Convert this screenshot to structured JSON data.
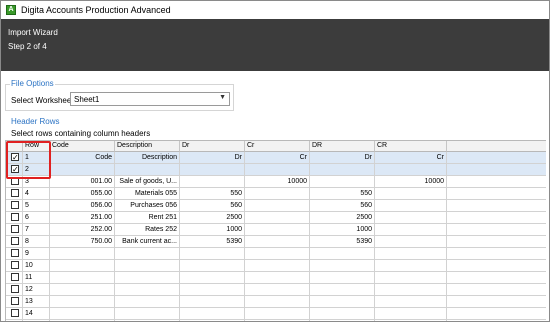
{
  "window": {
    "title": "Digita Accounts Production Advanced",
    "icon": "app-logo-icon"
  },
  "wizard": {
    "title": "Import Wizard",
    "step": "Step 2 of 4"
  },
  "file_options": {
    "group_label": "File Options",
    "worksheet_label": "Select Worksheet",
    "worksheet_value": "Sheet1"
  },
  "header_rows": {
    "group_label": "Header Rows",
    "instruction": "Select rows containing column headers"
  },
  "grid": {
    "columns": [
      "Row",
      "Code",
      "Description",
      "Dr",
      "Cr",
      "DR",
      "CR"
    ],
    "rows": [
      {
        "row": "1",
        "checked": true,
        "selected": true,
        "code": "Code",
        "description": "Description",
        "dr": "Dr",
        "cr": "Cr",
        "DR": "Dr",
        "CR": "Cr"
      },
      {
        "row": "2",
        "checked": true,
        "selected": true,
        "code": "",
        "description": "",
        "dr": "",
        "cr": "",
        "DR": "",
        "CR": ""
      },
      {
        "row": "3",
        "checked": false,
        "selected": false,
        "code": "001.00",
        "description": "Sale of goods, U...",
        "dr": "",
        "cr": "10000",
        "DR": "",
        "CR": "10000"
      },
      {
        "row": "4",
        "checked": false,
        "selected": false,
        "code": "055.00",
        "description": "Materials 055",
        "dr": "550",
        "cr": "",
        "DR": "550",
        "CR": ""
      },
      {
        "row": "5",
        "checked": false,
        "selected": false,
        "code": "056.00",
        "description": "Purchases 056",
        "dr": "560",
        "cr": "",
        "DR": "560",
        "CR": ""
      },
      {
        "row": "6",
        "checked": false,
        "selected": false,
        "code": "251.00",
        "description": "Rent 251",
        "dr": "2500",
        "cr": "",
        "DR": "2500",
        "CR": ""
      },
      {
        "row": "7",
        "checked": false,
        "selected": false,
        "code": "252.00",
        "description": "Rates 252",
        "dr": "1000",
        "cr": "",
        "DR": "1000",
        "CR": ""
      },
      {
        "row": "8",
        "checked": false,
        "selected": false,
        "code": "750.00",
        "description": "Bank current ac...",
        "dr": "5390",
        "cr": "",
        "DR": "5390",
        "CR": ""
      },
      {
        "row": "9",
        "checked": false,
        "selected": false,
        "code": "",
        "description": "",
        "dr": "",
        "cr": "",
        "DR": "",
        "CR": ""
      },
      {
        "row": "10",
        "checked": false,
        "selected": false,
        "code": "",
        "description": "",
        "dr": "",
        "cr": "",
        "DR": "",
        "CR": ""
      },
      {
        "row": "11",
        "checked": false,
        "selected": false,
        "code": "",
        "description": "",
        "dr": "",
        "cr": "",
        "DR": "",
        "CR": ""
      },
      {
        "row": "12",
        "checked": false,
        "selected": false,
        "code": "",
        "description": "",
        "dr": "",
        "cr": "",
        "DR": "",
        "CR": ""
      },
      {
        "row": "13",
        "checked": false,
        "selected": false,
        "code": "",
        "description": "",
        "dr": "",
        "cr": "",
        "DR": "",
        "CR": ""
      },
      {
        "row": "14",
        "checked": false,
        "selected": false,
        "code": "",
        "description": "",
        "dr": "",
        "cr": "",
        "DR": "",
        "CR": ""
      },
      {
        "row": "15",
        "checked": false,
        "selected": false,
        "code": "",
        "description": "",
        "dr": "",
        "cr": "",
        "DR": "",
        "CR": ""
      }
    ]
  },
  "colors": {
    "header_band": "#3c3c3c",
    "group_title": "#2b73c4",
    "highlight": "#e02020",
    "selected_row": "#dce8f6"
  }
}
